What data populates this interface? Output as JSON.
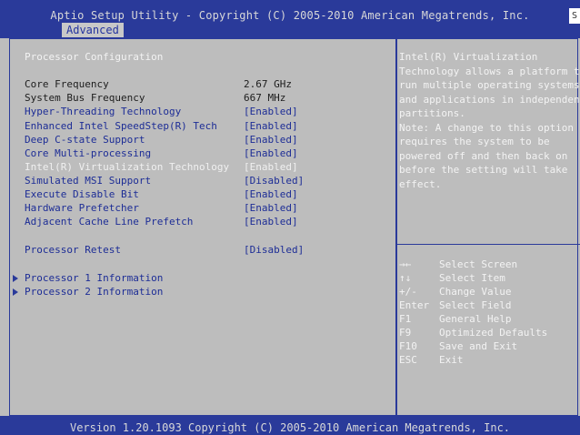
{
  "header": {
    "title": "Aptio Setup Utility - Copyright (C) 2005-2010 American Megatrends, Inc.",
    "active_tab": "Advanced",
    "corner_mark": "S"
  },
  "section_title": "Processor Configuration",
  "info_rows": [
    {
      "label": "Core Frequency",
      "value": "2.67 GHz"
    },
    {
      "label": "System Bus Frequency",
      "value": "667 MHz"
    }
  ],
  "settings": [
    {
      "label": "Hyper-Threading Technology",
      "value": "[Enabled]"
    },
    {
      "label": "Enhanced Intel SpeedStep(R) Tech",
      "value": "[Enabled]"
    },
    {
      "label": "Deep C-state Support",
      "value": "[Enabled]"
    },
    {
      "label": "Core Multi-processing",
      "value": "[Enabled]"
    },
    {
      "label": "Intel(R) Virtualization Technology",
      "value": "[Enabled]"
    },
    {
      "label": "Simulated MSI Support",
      "value": "[Disabled]"
    },
    {
      "label": "Execute Disable Bit",
      "value": "[Enabled]"
    },
    {
      "label": "Hardware Prefetcher",
      "value": "[Enabled]"
    },
    {
      "label": "Adjacent Cache Line Prefetch",
      "value": "[Enabled]"
    }
  ],
  "retest": {
    "label": "Processor Retest",
    "value": "[Disabled]"
  },
  "submenus": [
    {
      "label": "Processor 1 Information"
    },
    {
      "label": "Processor 2 Information"
    }
  ],
  "help": {
    "lines": [
      "Intel(R) Virtualization",
      "Technology allows a platform to",
      "run multiple operating systems",
      "and applications in independent",
      "partitions.",
      "Note: A change to this option",
      "requires the system to be",
      "powered off and then back on",
      "before the setting will take",
      "effect."
    ]
  },
  "keys": [
    {
      "key": "→←",
      "desc": "Select Screen"
    },
    {
      "key": "↑↓",
      "desc": "Select Item"
    },
    {
      "key": "+/-",
      "desc": "Change Value"
    },
    {
      "key": "Enter",
      "desc": "Select Field"
    },
    {
      "key": "F1",
      "desc": "General Help"
    },
    {
      "key": "F9",
      "desc": "Optimized Defaults"
    },
    {
      "key": "F10",
      "desc": "Save and Exit"
    },
    {
      "key": "ESC",
      "desc": "Exit"
    }
  ],
  "footer": {
    "text": "Version 1.20.1093 Copyright (C) 2005-2010 American Megatrends, Inc."
  },
  "colors": {
    "bar_blue": "#2a3a9a",
    "panel_grey": "#bdbdbd",
    "setting_text": "#1d2d96",
    "highlight_text": "#f3f3f3"
  }
}
